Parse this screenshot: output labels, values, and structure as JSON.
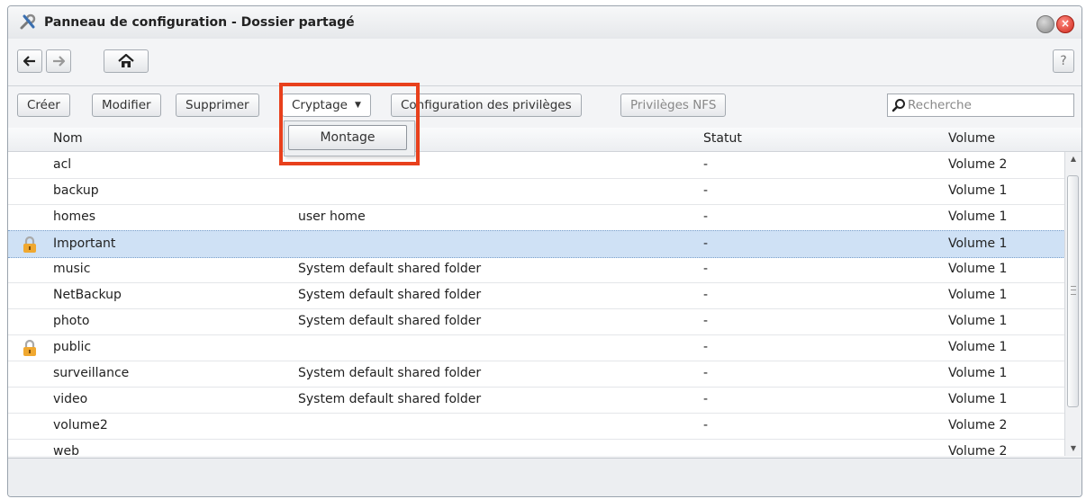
{
  "window": {
    "title": "Panneau de configuration - Dossier partagé",
    "close_glyph": "×"
  },
  "nav": {
    "back_icon": "arrow-left-icon",
    "forward_icon": "arrow-right-icon",
    "home_icon": "home-icon",
    "help": "?"
  },
  "toolbar": {
    "create": "Créer",
    "edit": "Modifier",
    "delete": "Supprimer",
    "encryption": "Cryptage",
    "encryption_caret": "▼",
    "privileges": "Configuration des privilèges",
    "nfs": "Privilèges NFS"
  },
  "search": {
    "placeholder": "Recherche"
  },
  "dropdown": {
    "items": [
      {
        "label": "Montage"
      }
    ]
  },
  "columns": {
    "name": "Nom",
    "status": "Statut",
    "volume": "Volume"
  },
  "rows": [
    {
      "name": "acl",
      "desc": "",
      "status": "-",
      "volume": "Volume 2",
      "locked": false,
      "selected": false
    },
    {
      "name": "backup",
      "desc": "",
      "status": "-",
      "volume": "Volume 1",
      "locked": false,
      "selected": false
    },
    {
      "name": "homes",
      "desc": "user home",
      "status": "-",
      "volume": "Volume 1",
      "locked": false,
      "selected": false
    },
    {
      "name": "Important",
      "desc": "",
      "status": "-",
      "volume": "Volume 1",
      "locked": true,
      "selected": true
    },
    {
      "name": "music",
      "desc": "System default shared folder",
      "status": "-",
      "volume": "Volume 1",
      "locked": false,
      "selected": false
    },
    {
      "name": "NetBackup",
      "desc": "System default shared folder",
      "status": "-",
      "volume": "Volume 1",
      "locked": false,
      "selected": false
    },
    {
      "name": "photo",
      "desc": "System default shared folder",
      "status": "-",
      "volume": "Volume 1",
      "locked": false,
      "selected": false
    },
    {
      "name": "public",
      "desc": "",
      "status": "-",
      "volume": "Volume 1",
      "locked": true,
      "selected": false
    },
    {
      "name": "surveillance",
      "desc": "System default shared folder",
      "status": "-",
      "volume": "Volume 1",
      "locked": false,
      "selected": false
    },
    {
      "name": "video",
      "desc": "System default shared folder",
      "status": "-",
      "volume": "Volume 1",
      "locked": false,
      "selected": false
    },
    {
      "name": "volume2",
      "desc": "",
      "status": "-",
      "volume": "Volume 2",
      "locked": false,
      "selected": false
    },
    {
      "name": "web",
      "desc": "",
      "status": "",
      "volume": "Volume 2",
      "locked": false,
      "selected": false
    }
  ],
  "colors": {
    "highlight": "#e8401c",
    "selected_row": "#cfe1f5",
    "lock": "#f0a830"
  }
}
